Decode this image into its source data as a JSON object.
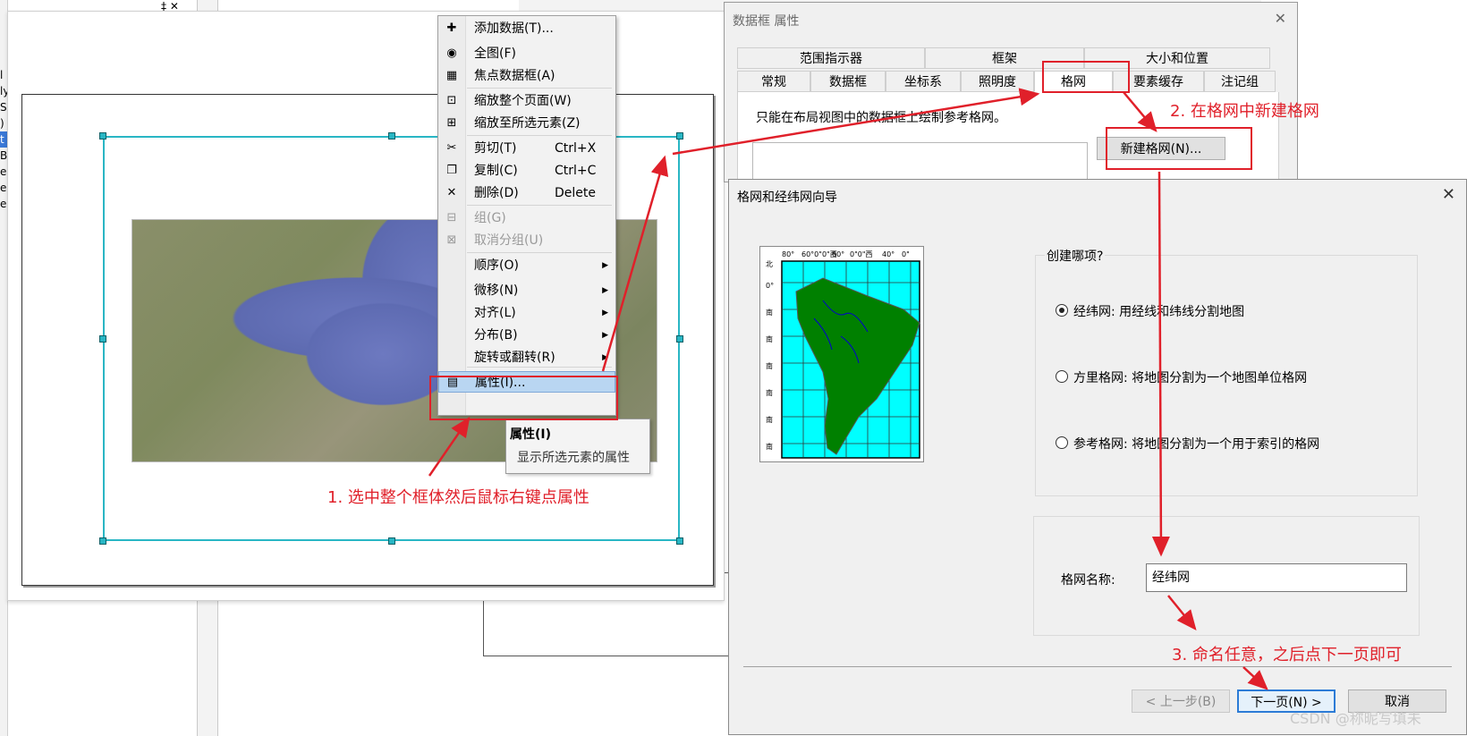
{
  "layout_menu": {
    "items": [
      {
        "icon": "plus-icon",
        "label": "添加数据(T)...",
        "shortcut": "",
        "arrow": "",
        "disabled": false
      },
      {
        "icon": "globe-icon",
        "label": "全图(F)",
        "shortcut": "",
        "arrow": "",
        "disabled": false
      },
      {
        "icon": "focus-frame-icon",
        "label": "焦点数据框(A)",
        "shortcut": "",
        "arrow": "",
        "disabled": false
      },
      {
        "icon": "zoom-page-icon",
        "label": "缩放整个页面(W)",
        "shortcut": "",
        "arrow": "",
        "disabled": false
      },
      {
        "icon": "zoom-selected-icon",
        "label": "缩放至所选元素(Z)",
        "shortcut": "",
        "arrow": "",
        "disabled": false
      },
      {
        "icon": "scissors-icon",
        "label": "剪切(T)",
        "shortcut": "Ctrl+X",
        "arrow": "",
        "disabled": false
      },
      {
        "icon": "copy-icon",
        "label": "复制(C)",
        "shortcut": "Ctrl+C",
        "arrow": "",
        "disabled": false
      },
      {
        "icon": "delete-icon",
        "label": "删除(D)",
        "shortcut": "Delete",
        "arrow": "",
        "disabled": false
      },
      {
        "icon": "group-icon",
        "label": "组(G)",
        "shortcut": "",
        "arrow": "",
        "disabled": true
      },
      {
        "icon": "ungroup-icon",
        "label": "取消分组(U)",
        "shortcut": "",
        "arrow": "",
        "disabled": true
      },
      {
        "icon": "",
        "label": "顺序(O)",
        "shortcut": "",
        "arrow": "▶",
        "disabled": false
      },
      {
        "icon": "",
        "label": "微移(N)",
        "shortcut": "",
        "arrow": "▶",
        "disabled": false
      },
      {
        "icon": "",
        "label": "对齐(L)",
        "shortcut": "",
        "arrow": "▶",
        "disabled": false
      },
      {
        "icon": "",
        "label": "分布(B)",
        "shortcut": "",
        "arrow": "▶",
        "disabled": false
      },
      {
        "icon": "",
        "label": "旋转或翻转(R)",
        "shortcut": "",
        "arrow": "▶",
        "disabled": false
      },
      {
        "icon": "properties-icon",
        "label": "属性(I)...",
        "shortcut": "",
        "arrow": "",
        "disabled": false,
        "highlighted": true
      }
    ],
    "icon_glyphs": {
      "plus-icon": "✚",
      "globe-icon": "◉",
      "focus-frame-icon": "▦",
      "zoom-page-icon": "⊡",
      "zoom-selected-icon": "⊞",
      "scissors-icon": "✂",
      "copy-icon": "❐",
      "delete-icon": "✕",
      "group-icon": "⊟",
      "ungroup-icon": "⊠",
      "properties-icon": "▤"
    }
  },
  "tooltip": {
    "title": "属性(I)",
    "description": "显示所选元素的属性"
  },
  "annotations": {
    "step1": "1. 选中整个框体然后鼠标右键点属性",
    "step2": "2. 在格网中新建格网",
    "step3": "3. 命名任意，之后点下一页即可"
  },
  "properties_dialog": {
    "title": "数据框 属性",
    "tabs_row1": [
      "范围指示器",
      "框架",
      "大小和位置"
    ],
    "tabs_row2": [
      "常规",
      "数据框",
      "坐标系",
      "照明度",
      "格网",
      "要素缓存",
      "注记组"
    ],
    "active_tab": "格网",
    "info_text": "只能在布局视图中的数据框上绘制参考格网。",
    "new_grid_button": "新建格网(N)..."
  },
  "wizard": {
    "title": "格网和经纬网向导",
    "preview_top_labels": [
      "80°",
      "60°0\"0\"西",
      "60°",
      "0\"0\"西",
      "40°",
      "0\""
    ],
    "preview_side_labels": [
      "北",
      "0°",
      "南",
      "南",
      "南",
      "南",
      "南",
      "南"
    ],
    "question": "创建哪项?",
    "options": [
      {
        "label": "经纬网: 用经线和纬线分割地图",
        "selected": true
      },
      {
        "label": "方里格网: 将地图分割为一个地图单位格网",
        "selected": false
      },
      {
        "label": "参考格网: 将地图分割为一个用于索引的格网",
        "selected": false
      }
    ],
    "name_label": "格网名称:",
    "name_value": "经纬网",
    "buttons": {
      "back": "< 上一步(B)",
      "next": "下一页(N) >",
      "cancel": "取消"
    }
  },
  "background": {
    "left_chars": [
      "l",
      "ly",
      "S",
      ")",
      "t",
      "B",
      "e:",
      "e:",
      "e:"
    ],
    "corner": "‡ ✕"
  },
  "watermark": "CSDN @称昵写填未",
  "colors": {
    "selection_frame": "#29b6c4",
    "annotation_red": "#e0202a",
    "menu_highlight": "#b9d6f2",
    "ocean": "#00ffff",
    "land": "#008000"
  }
}
